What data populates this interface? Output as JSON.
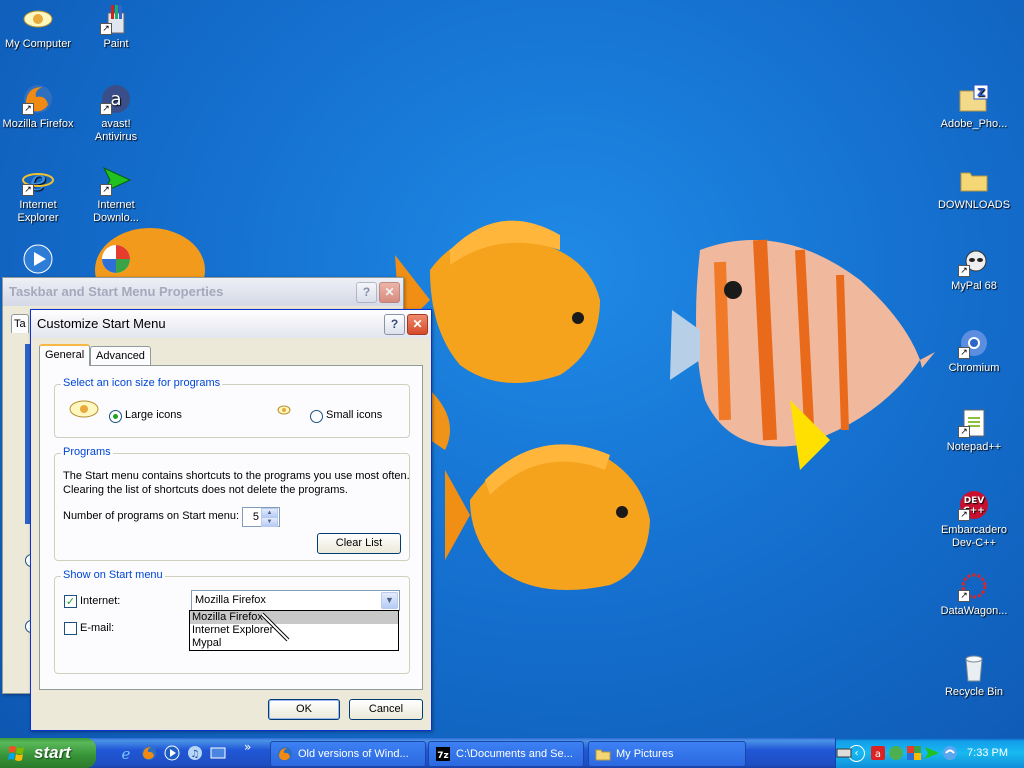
{
  "desktop_icons": [
    {
      "label": "My Computer",
      "icon": "computer-icon"
    },
    {
      "label": "Paint",
      "icon": "paint-icon"
    },
    {
      "label": "Mozilla Firefox",
      "icon": "firefox-icon"
    },
    {
      "label": "avast!\nAntivirus",
      "icon": "avast-icon"
    },
    {
      "label": "Internet\nExplorer",
      "icon": "ie-icon"
    },
    {
      "label": "Internet\nDownlo...",
      "icon": "idm-icon"
    },
    {
      "label": "Adobe_Pho...",
      "icon": "zip-folder-icon"
    },
    {
      "label": "DOWNLOADS",
      "icon": "folder-icon"
    },
    {
      "label": "MyPal 68",
      "icon": "mypal-icon"
    },
    {
      "label": "Chromium",
      "icon": "chromium-icon"
    },
    {
      "label": "Notepad++",
      "icon": "notepadpp-icon"
    },
    {
      "label": "Embarcadero\nDev-C++",
      "icon": "devcpp-icon"
    },
    {
      "label": "DataWagon...",
      "icon": "datawagon-icon"
    },
    {
      "label": "Recycle Bin",
      "icon": "recycle-bin-icon"
    }
  ],
  "parent_window": {
    "title": "Taskbar and Start Menu Properties",
    "tab_fragment": "Ta"
  },
  "dialog": {
    "title": "Customize Start Menu",
    "help_glyph": "?",
    "close_glyph": "✕",
    "tabs": [
      {
        "label": "General",
        "selected": true
      },
      {
        "label": "Advanced",
        "selected": false
      }
    ],
    "icon_size": {
      "group_label": "Select an icon size for programs",
      "large_label": "Large icons",
      "small_label": "Small icons",
      "selected": "large"
    },
    "programs": {
      "group_label": "Programs",
      "description_line1": "The Start menu contains shortcuts to the programs you use most often.",
      "description_line2": "Clearing the list of shortcuts does not delete the programs.",
      "count_label": "Number of programs on Start menu:",
      "count_value": "5",
      "clear_button": "Clear List"
    },
    "show_on_start": {
      "group_label": "Show on Start menu",
      "internet_label": "Internet:",
      "internet_checked": true,
      "internet_value": "Mozilla Firefox",
      "email_label": "E-mail:",
      "email_checked": false,
      "dropdown_options": [
        "Mozilla Firefox",
        "Internet Explorer",
        "Mypal"
      ],
      "highlighted_option": "Mozilla Firefox"
    },
    "ok_label": "OK",
    "cancel_label": "Cancel"
  },
  "taskbar": {
    "start_label": "start",
    "quick_launch": [
      "ie-icon",
      "firefox-icon",
      "media-player-icon",
      "itunes-icon",
      "show-desktop-icon"
    ],
    "quick_launch_chevron": "»",
    "tasks": [
      {
        "label": "Old versions of Wind...",
        "icon": "firefox-icon"
      },
      {
        "label": "C:\\Documents and Se...",
        "icon": "7zip-icon"
      },
      {
        "label": "My Pictures",
        "icon": "folder-icon"
      }
    ],
    "clock": "7:33 PM"
  },
  "colors": {
    "desktop_blue": "#1570cf",
    "dialog_face": "#ece9d8",
    "group_label_blue": "#0046d5",
    "taskbar_blue": "#2157d7",
    "start_green": "#379237"
  }
}
